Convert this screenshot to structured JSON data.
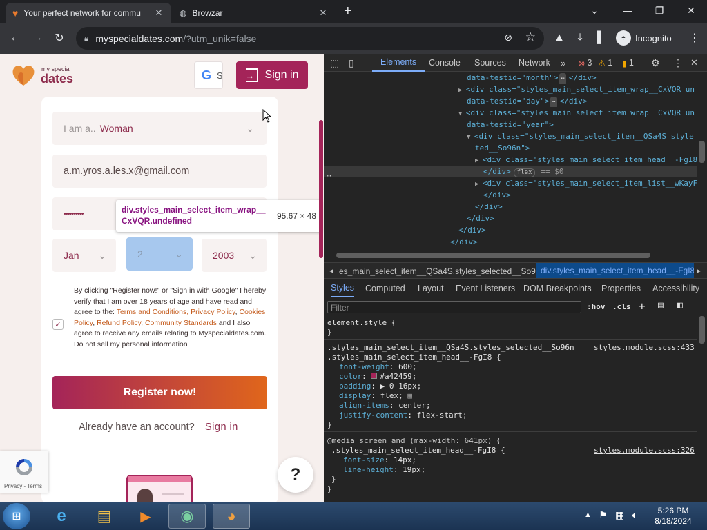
{
  "browser": {
    "tabs": [
      {
        "title": "Your perfect network for commu",
        "active": true
      },
      {
        "title": "Browzar",
        "active": false
      }
    ],
    "url_host": "myspecialdates.com",
    "url_path": "/?utm_unik=false",
    "profile_label": "Incognito"
  },
  "site": {
    "logo_small": "my special",
    "logo_big": "dates",
    "google_letter": "G",
    "google_partial": "S",
    "signin_label": "Sign in",
    "gender_prefix": "I am a..",
    "gender_value": "Woman",
    "email_value": "a.m.yros.a.les.x@gmail.com",
    "password_dots": "••••••••••",
    "dob_month": "Jan",
    "dob_day": "2",
    "dob_year": "2003",
    "tooltip_title": "div.styles_main_select_item_wrap__CxVQR.undefined",
    "tooltip_size": "95.67 × 48",
    "consent_text_1": "By clicking \"Register now!\" or \"Sign in with Google\" I hereby verify that I am over 18 years of age and have read and agree to the: ",
    "consent_links_1": "Terms and Conditions, Privacy Policy",
    "consent_sep_1": ", ",
    "consent_link_cookies": "Cookies Policy",
    "consent_link_refund": "Refund Policy",
    "consent_link_community": "Community Standards",
    "consent_text_2": " and I also agree to receive any emails relating to Myspecialdates.com. Do not sell my personal information",
    "register_label": "Register now!",
    "have_account": "Already have an account?",
    "signin_link": "Sign in",
    "help_label": "?",
    "recaptcha_label": "Privacy - Terms"
  },
  "devtools": {
    "tabs": [
      "Elements",
      "Console",
      "Sources",
      "Network"
    ],
    "errors": "3",
    "warnings": "1",
    "issues": "1",
    "dom_lines": [
      {
        "indent": 0,
        "html": "data-testid=\"month\">",
        "trail": "</div>"
      },
      {
        "indent": 0,
        "html": "<div class=\"styles_main_select_item_wrap__CxVQR un",
        "arrow": "▶"
      },
      {
        "indent": 0,
        "html": "data-testid=\"day\">",
        "trail": "</div>"
      },
      {
        "indent": 0,
        "html": "<div class=\"styles_main_select_item_wrap__CxVQR un",
        "arrow": "▼"
      },
      {
        "indent": 0,
        "html": "data-testid=\"year\">"
      },
      {
        "indent": 1,
        "html": "<div class=\"styles_main_select_item__QSa4S  style",
        "arrow": "▼"
      },
      {
        "indent": 1,
        "html": "ted__So96n\">"
      },
      {
        "indent": 2,
        "html": "<div class=\"styles_main_select_item_head__-FgI8",
        "arrow": "▶"
      },
      {
        "indent": 2,
        "html": "</div>",
        "badge": "flex",
        "trail": "== $0"
      },
      {
        "indent": 2,
        "html": "<div class=\"styles_main_select_item_list__wKayF",
        "arrow": "▶"
      },
      {
        "indent": 2,
        "html": "</div>"
      },
      {
        "indent": 1,
        "html": "</div>"
      },
      {
        "indent": 0,
        "html": "</div>"
      },
      {
        "indent": -1,
        "html": "</div>"
      },
      {
        "indent": -2,
        "html": "</div>"
      }
    ],
    "breadcrumb_1": "es_main_select_item__QSa4S.styles_selected__So96n",
    "breadcrumb_2": "div.styles_main_select_item_head__-FgI8",
    "subtabs": [
      "Styles",
      "Computed",
      "Layout",
      "Event Listeners",
      "DOM Breakpoints",
      "Properties",
      "Accessibility"
    ],
    "filter_placeholder": "Filter",
    "hov_label": ":hov",
    "cls_label": ".cls",
    "element_style": "element.style {",
    "close_brace": "}",
    "rule1_selector_1": ".styles_main_select_item__QSa4S.styles_selected__So96n",
    "rule1_selector_2": ".styles_main_select_item_head__-FgI8 {",
    "rule1_source": "styles.module.scss:433",
    "rule1_props": [
      {
        "name": "font-weight",
        "value": "600;"
      },
      {
        "name": "color",
        "value": "#a42459;"
      },
      {
        "name": "padding",
        "value": "▶ 0 16px;"
      },
      {
        "name": "display",
        "value": "flex;"
      },
      {
        "name": "align-items",
        "value": "center;"
      },
      {
        "name": "justify-content",
        "value": "flex-start;"
      }
    ],
    "media_query": "@media screen and (max-width: 641px) {",
    "rule2_selector": ".styles_main_select_item_head__-FgI8 {",
    "rule2_source": "styles.module.scss:326",
    "rule2_props": [
      {
        "name": "font-size",
        "value": "14px;"
      },
      {
        "name": "line-height",
        "value": "19px;"
      }
    ]
  },
  "taskbar": {
    "time": "5:26 PM",
    "date": "8/18/2024"
  },
  "colors": {
    "brand_maroon": "#a42459",
    "brand_orange": "#e0661b",
    "devtools_bg": "#242424",
    "accent_blue": "#7cacf8"
  }
}
